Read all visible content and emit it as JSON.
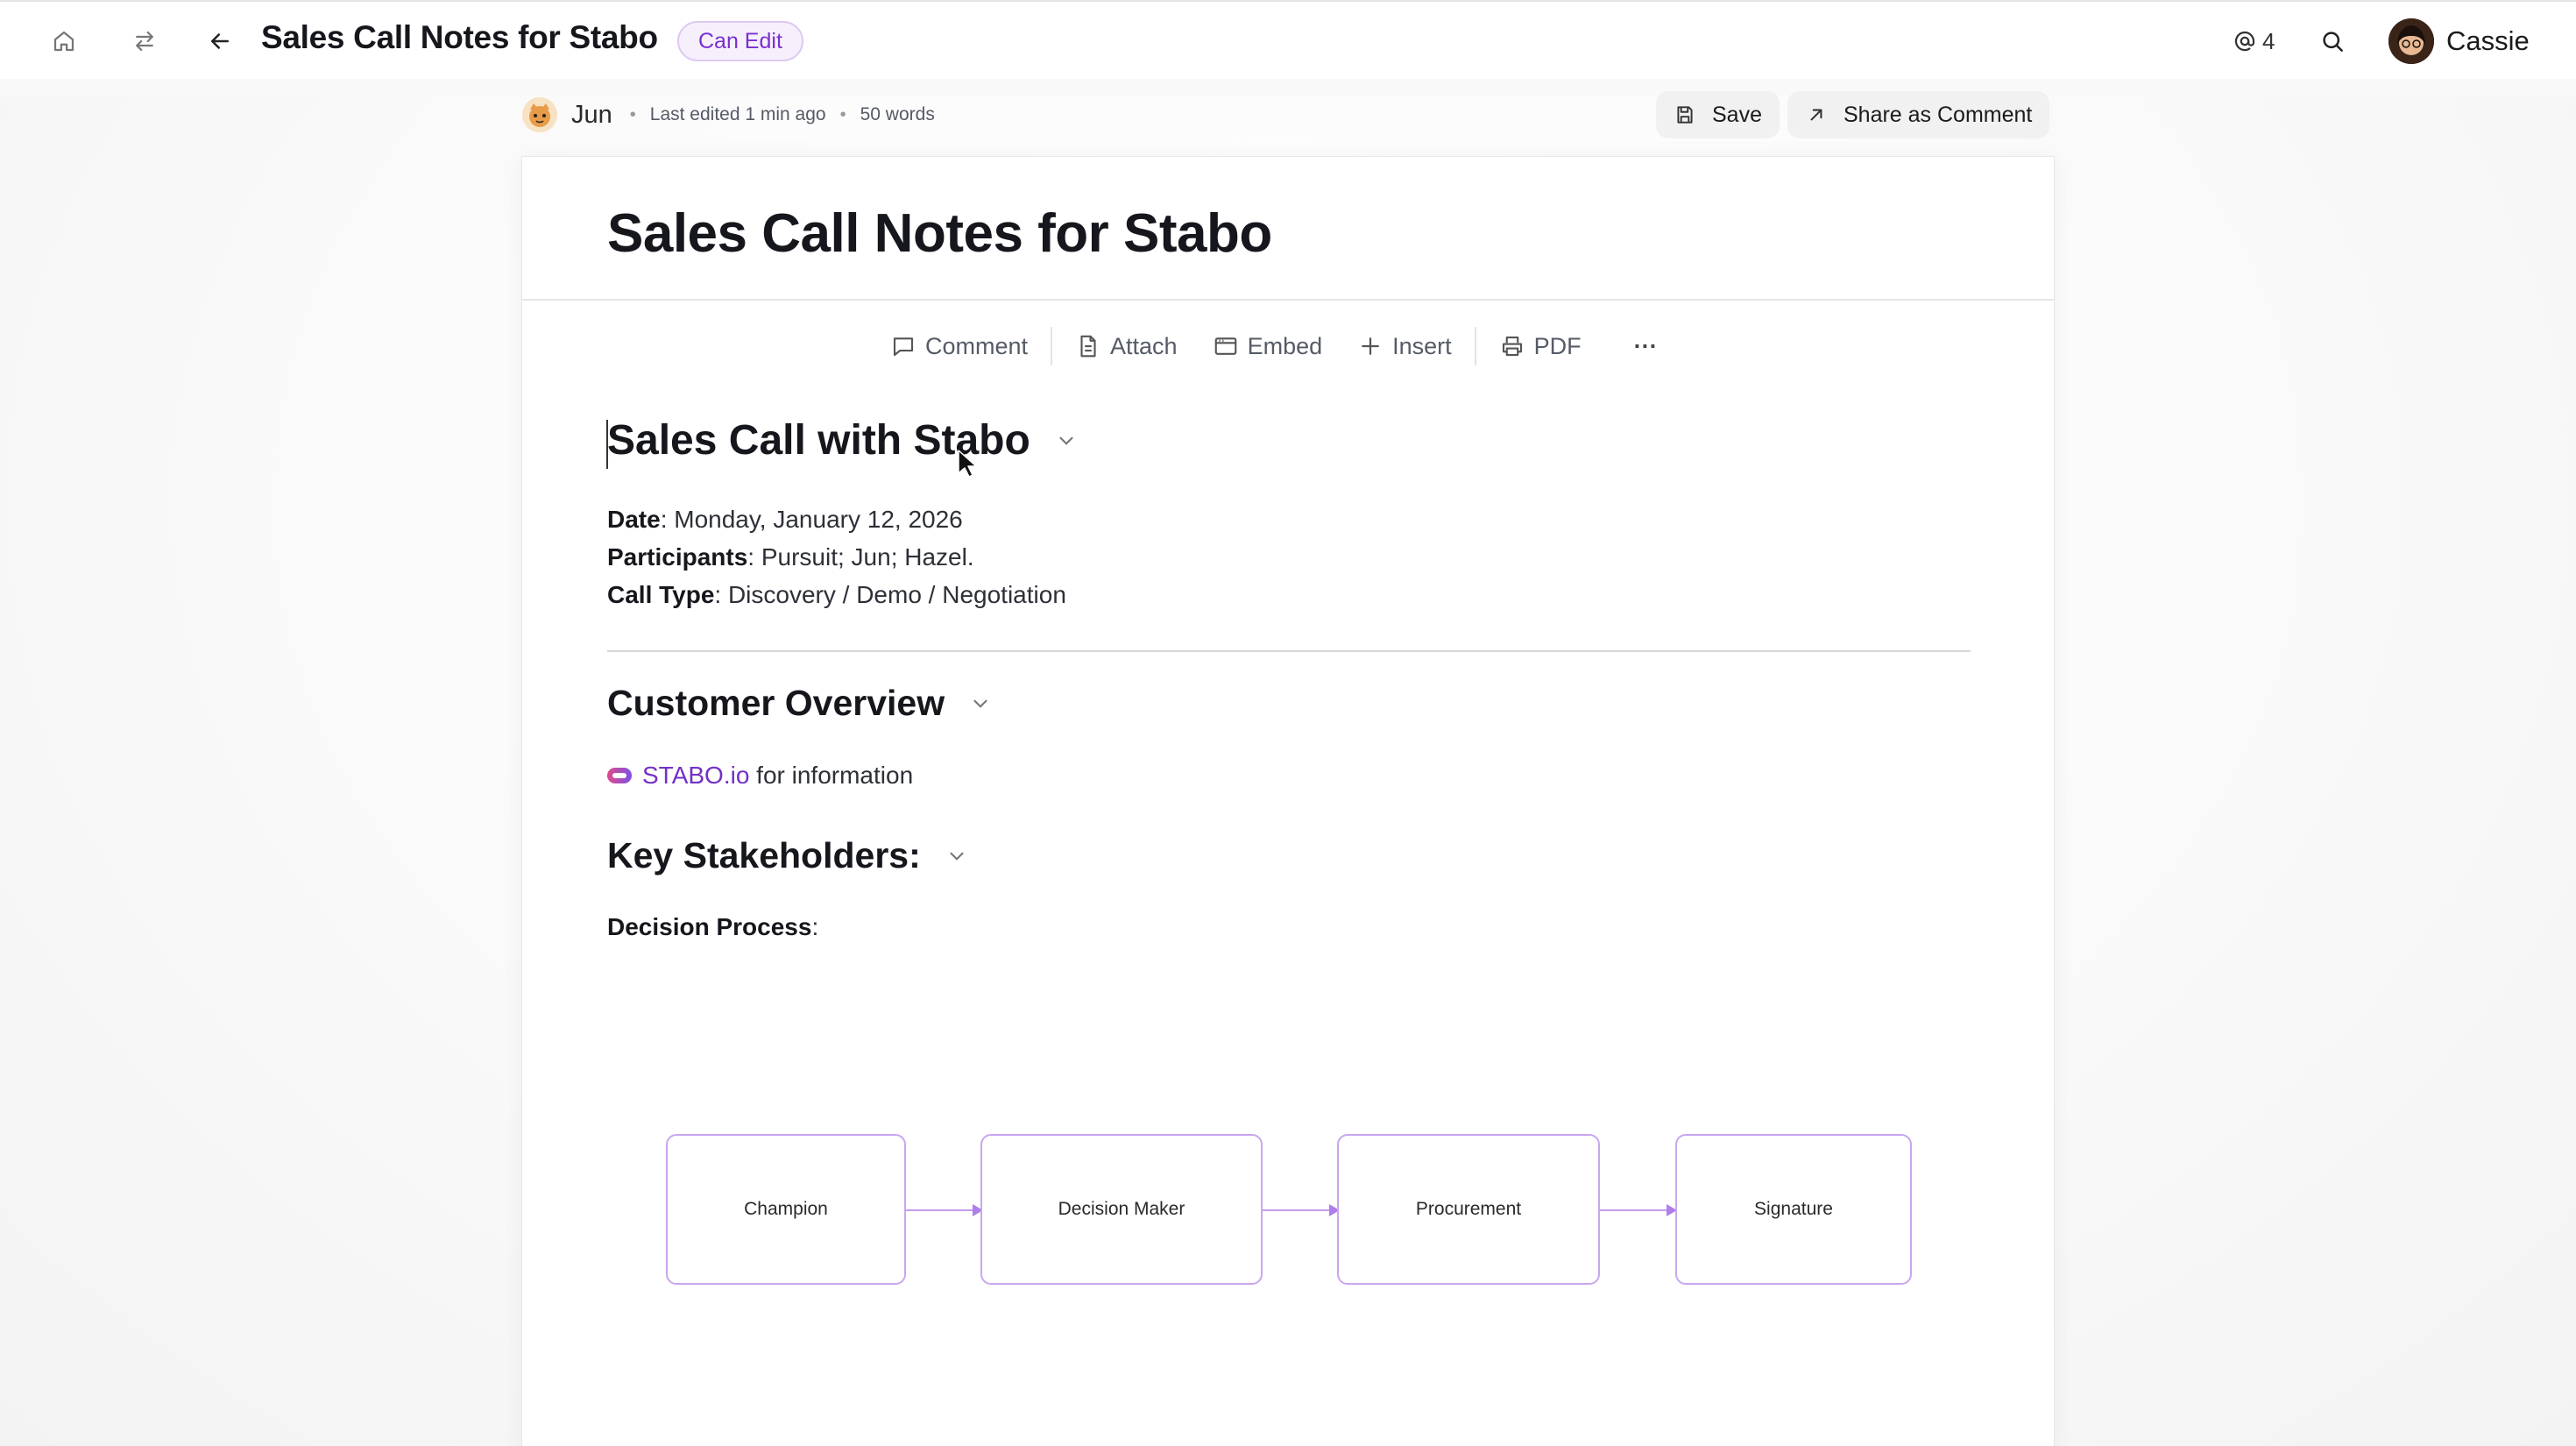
{
  "topbar": {
    "title": "Sales Call Notes for Stabo",
    "permission_badge": "Can Edit",
    "mentions_count": "4",
    "user_name": "Cassie"
  },
  "meta": {
    "author": "Jun",
    "last_edited": "Last edited 1 min ago",
    "word_count": "50 words"
  },
  "actions": {
    "save_label": "Save",
    "share_label": "Share as Comment"
  },
  "document": {
    "title": "Sales Call Notes for Stabo",
    "toolbar": {
      "comment": "Comment",
      "attach": "Attach",
      "embed": "Embed",
      "insert": "Insert",
      "pdf": "PDF",
      "more": "···"
    },
    "section1": {
      "heading": "Sales Call with Stabo",
      "date_label": "Date",
      "date_value": ": Monday, January 12, 2026",
      "participants_label": "Participants",
      "participants_value": ": Pursuit; Jun; Hazel.",
      "call_type_label": "Call Type",
      "call_type_value": ": Discovery / Demo / Negotiation"
    },
    "section2": {
      "heading": "Customer Overview",
      "link_text": "STABO.io",
      "link_suffix": " for information"
    },
    "section3": {
      "heading": "Key Stakeholders:",
      "decision_label": "Decision Process",
      "decision_suffix": ":"
    },
    "flow": [
      "Champion",
      "Decision Maker",
      "Procurement",
      "Signature"
    ]
  },
  "colors": {
    "accent": "#7b2fd0",
    "badge_bg": "#f6f0fd",
    "node_border": "#c9a6ee"
  }
}
